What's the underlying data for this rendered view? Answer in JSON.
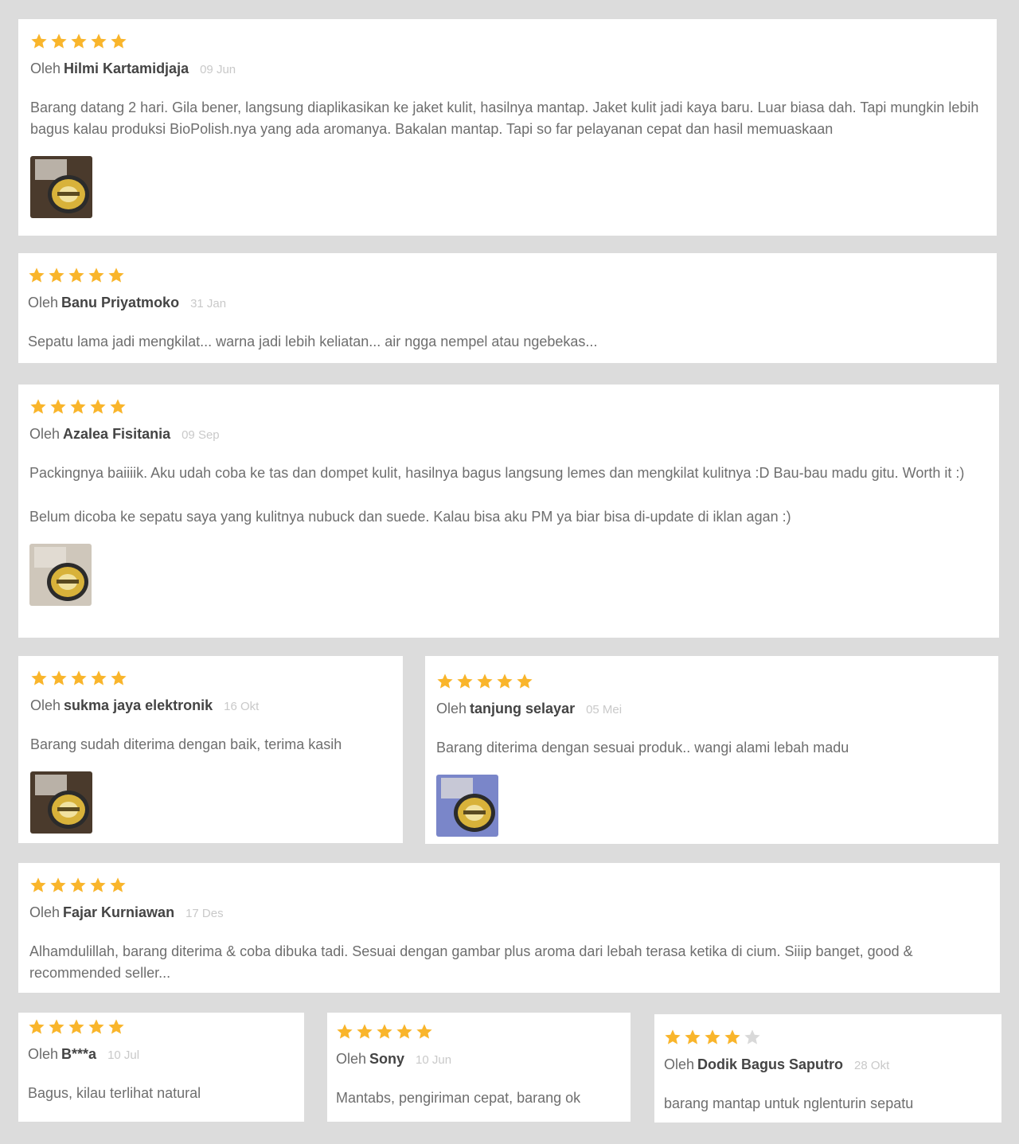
{
  "colors": {
    "star_on": "#f9b52b",
    "star_off": "#d9d9d9",
    "background": "#dcdcdc"
  },
  "by_label": "Oleh",
  "reviews": [
    {
      "rating": 5,
      "author": "Hilmi Kartamidjaja",
      "date": "09 Jun",
      "text": [
        "Barang datang 2 hari. Gila bener, langsung diaplikasikan ke jaket kulit, hasilnya mantap. Jaket kulit jadi kaya baru. Luar biasa dah. Tapi mungkin lebih bagus kalau produksi BioPolish.nya yang ada aromanya. Bakalan mantap. Tapi so far pelayanan cepat dan hasil memuaskaan"
      ],
      "photo": "product-photo"
    },
    {
      "rating": 5,
      "author": "Banu Priyatmoko",
      "date": "31 Jan",
      "text": [
        "Sepatu lama jadi mengkilat... warna jadi lebih keliatan... air ngga nempel atau ngebekas..."
      ]
    },
    {
      "rating": 5,
      "author": "Azalea Fisitania",
      "date": "09 Sep",
      "text": [
        "Packingnya baiiiik. Aku udah coba ke tas dan dompet kulit, hasilnya bagus langsung lemes dan mengkilat kulitnya :D Bau-bau madu gitu. Worth it :)",
        "Belum dicoba ke sepatu saya yang kulitnya nubuck dan suede. Kalau bisa aku PM ya biar bisa di-update di iklan agan :)"
      ],
      "photo": "product-photo"
    },
    {
      "rating": 5,
      "author": "sukma jaya elektronik",
      "date": "16 Okt",
      "text": [
        "Barang sudah diterima dengan baik, terima kasih"
      ],
      "photo": "product-photo"
    },
    {
      "rating": 5,
      "author": "tanjung selayar",
      "date": "05 Mei",
      "text": [
        "Barang diterima dengan sesuai produk.. wangi alami lebah madu"
      ],
      "photo": "product-photo"
    },
    {
      "rating": 5,
      "author": "Fajar Kurniawan",
      "date": "17 Des",
      "text": [
        "Alhamdulillah, barang diterima & coba dibuka tadi. Sesuai dengan gambar plus aroma dari lebah terasa ketika di cium. Siiip banget, good & recommended seller..."
      ]
    },
    {
      "rating": 5,
      "author": "B***a",
      "date": "10 Jul",
      "text": [
        "Bagus, kilau terlihat natural"
      ]
    },
    {
      "rating": 5,
      "author": "Sony",
      "date": "10 Jun",
      "text": [
        "Mantabs, pengiriman cepat, barang ok"
      ]
    },
    {
      "rating": 4,
      "author": "Dodik Bagus Saputro",
      "date": "28 Okt",
      "text": [
        "barang mantap untuk nglenturin sepatu"
      ]
    }
  ]
}
